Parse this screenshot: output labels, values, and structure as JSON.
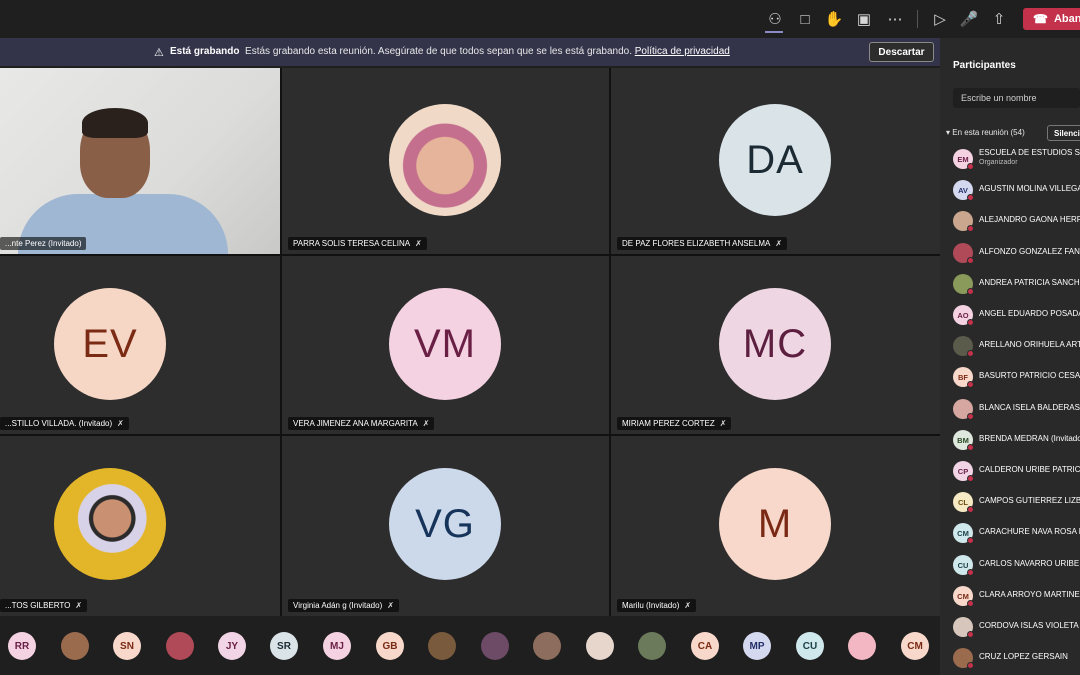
{
  "toolbar": {
    "icons": [
      "participants-icon",
      "chat-icon",
      "raise-hand-icon",
      "breakout-icon",
      "more-icon",
      "camera-off-icon",
      "mic-off-icon",
      "share-icon"
    ],
    "leave_label": "Abandonar"
  },
  "banner": {
    "bold": "Está grabando",
    "text": "Estás grabando esta reunión. Asegúrate de que todos sepan que se les está grabando.",
    "link": "Política de privacidad",
    "dismiss_label": "Descartar"
  },
  "tiles": [
    {
      "name": "...nte Perez (Invitado)",
      "type": "video"
    },
    {
      "name": "PARRA SOLIS TERESA CELINA",
      "type": "photo"
    },
    {
      "name": "DE PAZ FLORES ELIZABETH ANSELMA",
      "initials": "DA",
      "bg": "#d9e3e8",
      "fg": "#1b2a33"
    },
    {
      "name": "...STILLO VILLADA. (Invitado)",
      "initials": "EV",
      "bg": "#f6d7c6",
      "fg": "#7b2a14"
    },
    {
      "name": "VERA JIMENEZ ANA MARGARITA",
      "initials": "VM",
      "bg": "#f4d2e2",
      "fg": "#6a1f45"
    },
    {
      "name": "MIRIAM PEREZ CORTEZ",
      "initials": "MC",
      "bg": "#eed6e2",
      "fg": "#5d1f40"
    },
    {
      "name": "...TOS GILBERTO",
      "type": "photo"
    },
    {
      "name": "Virginia Adán g (Invitado)",
      "initials": "VG",
      "bg": "#cbd9ea",
      "fg": "#16335a"
    },
    {
      "name": "Marilu (Invitado)",
      "initials": "M",
      "bg": "#f7d8cb",
      "fg": "#7a2a14"
    }
  ],
  "strip": [
    {
      "initials": "RR",
      "bg": "#f4d2e2",
      "fg": "#6a1f45"
    },
    {
      "initials": "",
      "bg": "#9b6b4e",
      "fg": "#fff"
    },
    {
      "initials": "SN",
      "bg": "#f7d8cb",
      "fg": "#7a2a14"
    },
    {
      "initials": "",
      "bg": "#b04a58",
      "fg": "#fff"
    },
    {
      "initials": "JY",
      "bg": "#f1d4e6",
      "fg": "#6a1f45"
    },
    {
      "initials": "SR",
      "bg": "#d9e3e8",
      "fg": "#1b2a33"
    },
    {
      "initials": "MJ",
      "bg": "#f4d2e2",
      "fg": "#6a1f45"
    },
    {
      "initials": "GB",
      "bg": "#f7d8cb",
      "fg": "#7a2a14"
    },
    {
      "initials": "",
      "bg": "#7a5a3c",
      "fg": "#fff"
    },
    {
      "initials": "",
      "bg": "#6d4a66",
      "fg": "#fff"
    },
    {
      "initials": "",
      "bg": "#8d6d5d",
      "fg": "#fff"
    },
    {
      "initials": "",
      "bg": "#e6d6cc",
      "fg": "#333"
    },
    {
      "initials": "",
      "bg": "#6b7a5a",
      "fg": "#fff"
    },
    {
      "initials": "CA",
      "bg": "#f7d8cb",
      "fg": "#7a2a14"
    },
    {
      "initials": "MP",
      "bg": "#d5d9f0",
      "fg": "#26306a"
    },
    {
      "initials": "CU",
      "bg": "#cfe8ec",
      "fg": "#1b4048"
    },
    {
      "initials": "",
      "bg": "#f2b7c2",
      "fg": "#333"
    },
    {
      "initials": "CM",
      "bg": "#f7d8cb",
      "fg": "#7a2a14"
    }
  ],
  "participants_panel": {
    "title": "Participantes",
    "search_placeholder": "Escribe un nombre",
    "section": "En esta reunión (54)",
    "mute_all_label": "Silenciar todos",
    "people": [
      {
        "initials": "EM",
        "name": "ESCUELA DE ESTUDIOS SUPERIORES",
        "role": "Organizador",
        "bg": "#f4d2e2",
        "fg": "#6a1f45"
      },
      {
        "initials": "AV",
        "name": "AGUSTIN MOLINA VILLEGAS",
        "bg": "#d5d9f0",
        "fg": "#26306a"
      },
      {
        "initials": "",
        "name": "ALEJANDRO GAONA HERRERA",
        "bg": "#caa68f",
        "fg": "#fff"
      },
      {
        "initials": "",
        "name": "ALFONZO GONZALEZ FANTI",
        "bg": "#b04a58",
        "fg": "#fff"
      },
      {
        "initials": "",
        "name": "ANDREA PATRICIA SANCHEZ",
        "bg": "#8a9a5a",
        "fg": "#fff"
      },
      {
        "initials": "AO",
        "name": "ANGEL EDUARDO POSADAS",
        "bg": "#f4d2e2",
        "fg": "#6a1f45"
      },
      {
        "initials": "",
        "name": "ARELLANO ORIHUELA ARTURO",
        "bg": "#5b5b4b",
        "fg": "#fff"
      },
      {
        "initials": "BF",
        "name": "BASURTO PATRICIO CESAR",
        "bg": "#f7d8cb",
        "fg": "#7a2a14"
      },
      {
        "initials": "",
        "name": "BLANCA ISELA BALDERAS",
        "bg": "#d6a7a0",
        "fg": "#fff"
      },
      {
        "initials": "BM",
        "name": "BRENDA MEDRAN (Invitado)",
        "bg": "#dfe8dc",
        "fg": "#2a4626"
      },
      {
        "initials": "CP",
        "name": "CALDERON URIBE PATRICIA",
        "bg": "#f1d4e6",
        "fg": "#6a1f45"
      },
      {
        "initials": "CL",
        "name": "CAMPOS GUTIERREZ LIZBETH",
        "bg": "#f6eac4",
        "fg": "#6a4f10"
      },
      {
        "initials": "CM",
        "name": "CARACHURE NAVA ROSA MARIA",
        "bg": "#cfe8ec",
        "fg": "#1b4048"
      },
      {
        "initials": "CU",
        "name": "CARLOS NAVARRO URIBE",
        "bg": "#cfe8ec",
        "fg": "#1b4048"
      },
      {
        "initials": "CM",
        "name": "CLARA ARROYO MARTINEZ",
        "bg": "#f7d8cb",
        "fg": "#7a2a14"
      },
      {
        "initials": "",
        "name": "CORDOVA ISLAS VIOLETA",
        "bg": "#d7c6bc",
        "fg": "#fff"
      },
      {
        "initials": "",
        "name": "CRUZ LOPEZ GERSAIN",
        "bg": "#9b6b4e",
        "fg": "#fff"
      }
    ]
  }
}
